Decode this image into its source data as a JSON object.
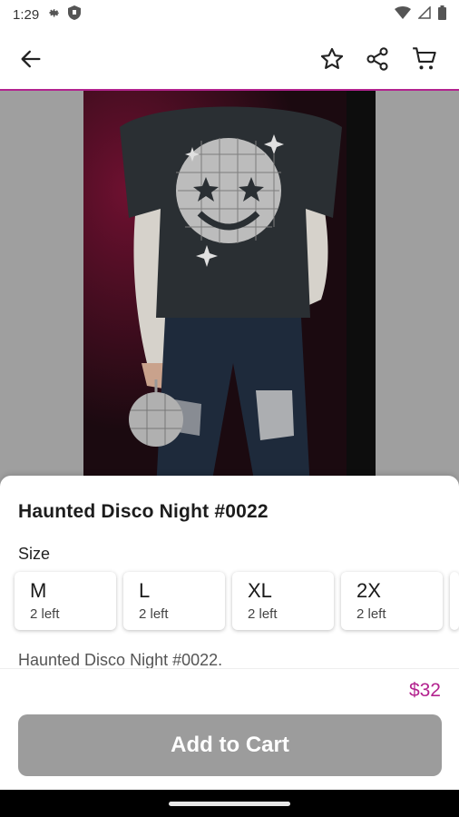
{
  "status_bar": {
    "time": "1:29"
  },
  "app_bar": {
    "back_icon": "arrow-left-icon",
    "favorite_icon": "star-outline-icon",
    "share_icon": "share-icon",
    "cart_icon": "cart-icon",
    "accent_color": "#b3238f"
  },
  "product": {
    "title": "Haunted Disco Night #0022",
    "size_label": "Size",
    "sizes": [
      {
        "name": "M",
        "stock": "2 left"
      },
      {
        "name": "L",
        "stock": "2 left"
      },
      {
        "name": "XL",
        "stock": "2 left"
      },
      {
        "name": "2X",
        "stock": "2 left"
      }
    ],
    "description": "Haunted Disco Night #0022.",
    "price": "$32",
    "price_color": "#b3238f"
  },
  "actions": {
    "add_to_cart": "Add to Cart",
    "button_color": "#9c9c9c"
  }
}
